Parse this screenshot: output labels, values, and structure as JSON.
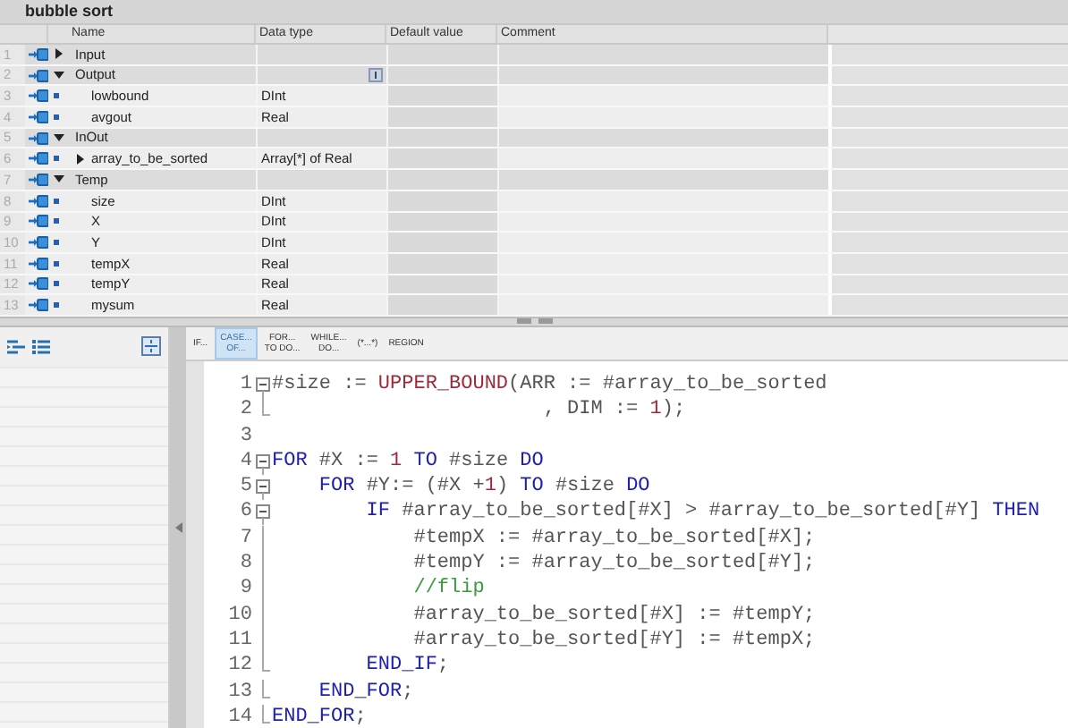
{
  "block_title": "bubble sort",
  "columns": [
    "Name",
    "Data type",
    "Default value",
    "Comment"
  ],
  "rows": [
    {
      "number": "1",
      "name": "Input",
      "kind": "section",
      "expanded": false
    },
    {
      "number": "2",
      "name": "Output",
      "kind": "section",
      "expanded": true,
      "picker_button": true,
      "children": [
        {
          "number": "3",
          "name": "lowbound",
          "kind": "member",
          "type": "DInt"
        },
        {
          "number": "4",
          "name": "avgout",
          "kind": "member",
          "type": "Real"
        }
      ]
    },
    {
      "number": "5",
      "name": "InOut",
      "kind": "section",
      "expanded": true,
      "children": [
        {
          "number": "6",
          "name": "array_to_be_sorted",
          "kind": "member",
          "type": "Array[*] of Real",
          "expanded": false
        }
      ]
    },
    {
      "number": "7",
      "name": "Temp",
      "kind": "section",
      "expanded": true,
      "children": [
        {
          "number": "8",
          "name": "size",
          "kind": "member",
          "type": "DInt"
        },
        {
          "number": "9",
          "name": "X",
          "kind": "member",
          "type": "DInt"
        },
        {
          "number": "10",
          "name": "Y",
          "kind": "member",
          "type": "DInt"
        },
        {
          "number": "11",
          "name": "tempX",
          "kind": "member",
          "type": "Real"
        },
        {
          "number": "12",
          "name": "tempY",
          "kind": "member",
          "type": "Real"
        },
        {
          "number": "13",
          "name": "mysum",
          "kind": "member",
          "type": "Real"
        }
      ]
    }
  ],
  "snippets": [
    {
      "lines": [
        "IF..."
      ],
      "selected": false
    },
    {
      "lines": [
        "CASE...",
        "OF..."
      ],
      "selected": true
    },
    {
      "lines": [
        "FOR...",
        "TO DO..."
      ],
      "selected": false
    },
    {
      "lines": [
        "WHILE...",
        "DO..."
      ],
      "selected": false
    },
    {
      "lines": [
        "(*...*)"
      ],
      "selected": false
    },
    {
      "lines": [
        "REGION"
      ],
      "selected": false
    }
  ],
  "code": [
    {
      "number": "1",
      "kind": "open",
      "tokens": [
        {
          "kind": "text",
          "text": "#size := "
        },
        {
          "kind": "function",
          "text": "UPPER_BOUND"
        },
        {
          "kind": "text",
          "text": "(ARR := #array_to_be_sorted"
        }
      ]
    },
    {
      "number": "2",
      "kind": "close",
      "tokens": [
        {
          "kind": "text",
          "text": "                       , DIM := "
        },
        {
          "kind": "number",
          "text": "1"
        },
        {
          "kind": "text",
          "text": ");"
        }
      ]
    },
    {
      "number": "3",
      "kind": "plain"
    },
    {
      "number": "4",
      "kind": "open",
      "tokens": [
        {
          "kind": "keyword",
          "text": "FOR"
        },
        {
          "kind": "text",
          "text": " #X := "
        },
        {
          "kind": "number",
          "text": "1 "
        },
        {
          "kind": "keyword",
          "text": "TO"
        },
        {
          "kind": "text",
          "text": " #size "
        },
        {
          "kind": "keyword",
          "text": "DO"
        }
      ]
    },
    {
      "number": "5",
      "kind": "open",
      "tokens": [
        {
          "kind": "keyword",
          "text": "    FOR"
        },
        {
          "kind": "text",
          "text": " #Y:= (#X +"
        },
        {
          "kind": "number",
          "text": "1"
        },
        {
          "kind": "text",
          "text": ") "
        },
        {
          "kind": "keyword",
          "text": "TO"
        },
        {
          "kind": "text",
          "text": " #size "
        },
        {
          "kind": "keyword",
          "text": "DO"
        }
      ]
    },
    {
      "number": "6",
      "kind": "open",
      "tokens": [
        {
          "kind": "keyword",
          "text": "        IF"
        },
        {
          "kind": "text",
          "text": " #array_to_be_sorted[#X] > #array_to_be_sorted[#Y] "
        },
        {
          "kind": "keyword",
          "text": "THEN"
        }
      ]
    },
    {
      "number": "7",
      "kind": "inner",
      "tokens": [
        {
          "kind": "text",
          "text": "            #tempX := #array_to_be_sorted[#X];"
        }
      ]
    },
    {
      "number": "8",
      "kind": "inner",
      "tokens": [
        {
          "kind": "text",
          "text": "            #tempY := #array_to_be_sorted[#Y];"
        }
      ]
    },
    {
      "number": "9",
      "kind": "inner",
      "tokens": [
        {
          "kind": "comment",
          "text": "            //flip"
        }
      ]
    },
    {
      "number": "10",
      "kind": "inner",
      "tokens": [
        {
          "kind": "text",
          "text": "            #array_to_be_sorted[#X] := #tempY;"
        }
      ]
    },
    {
      "number": "11",
      "kind": "inner",
      "tokens": [
        {
          "kind": "text",
          "text": "            #array_to_be_sorted[#Y] := #tempX;"
        }
      ]
    },
    {
      "number": "12",
      "kind": "close",
      "tokens": [
        {
          "kind": "keyword",
          "text": "        END_IF"
        },
        {
          "kind": "text",
          "text": ";"
        }
      ]
    },
    {
      "number": "13",
      "kind": "close",
      "tokens": [
        {
          "kind": "keyword",
          "text": "    END_FOR"
        },
        {
          "kind": "text",
          "text": ";"
        }
      ]
    },
    {
      "number": "14",
      "kind": "close",
      "tokens": [
        {
          "kind": "keyword",
          "text": "END_FOR"
        },
        {
          "kind": "text",
          "text": ";"
        }
      ]
    }
  ]
}
